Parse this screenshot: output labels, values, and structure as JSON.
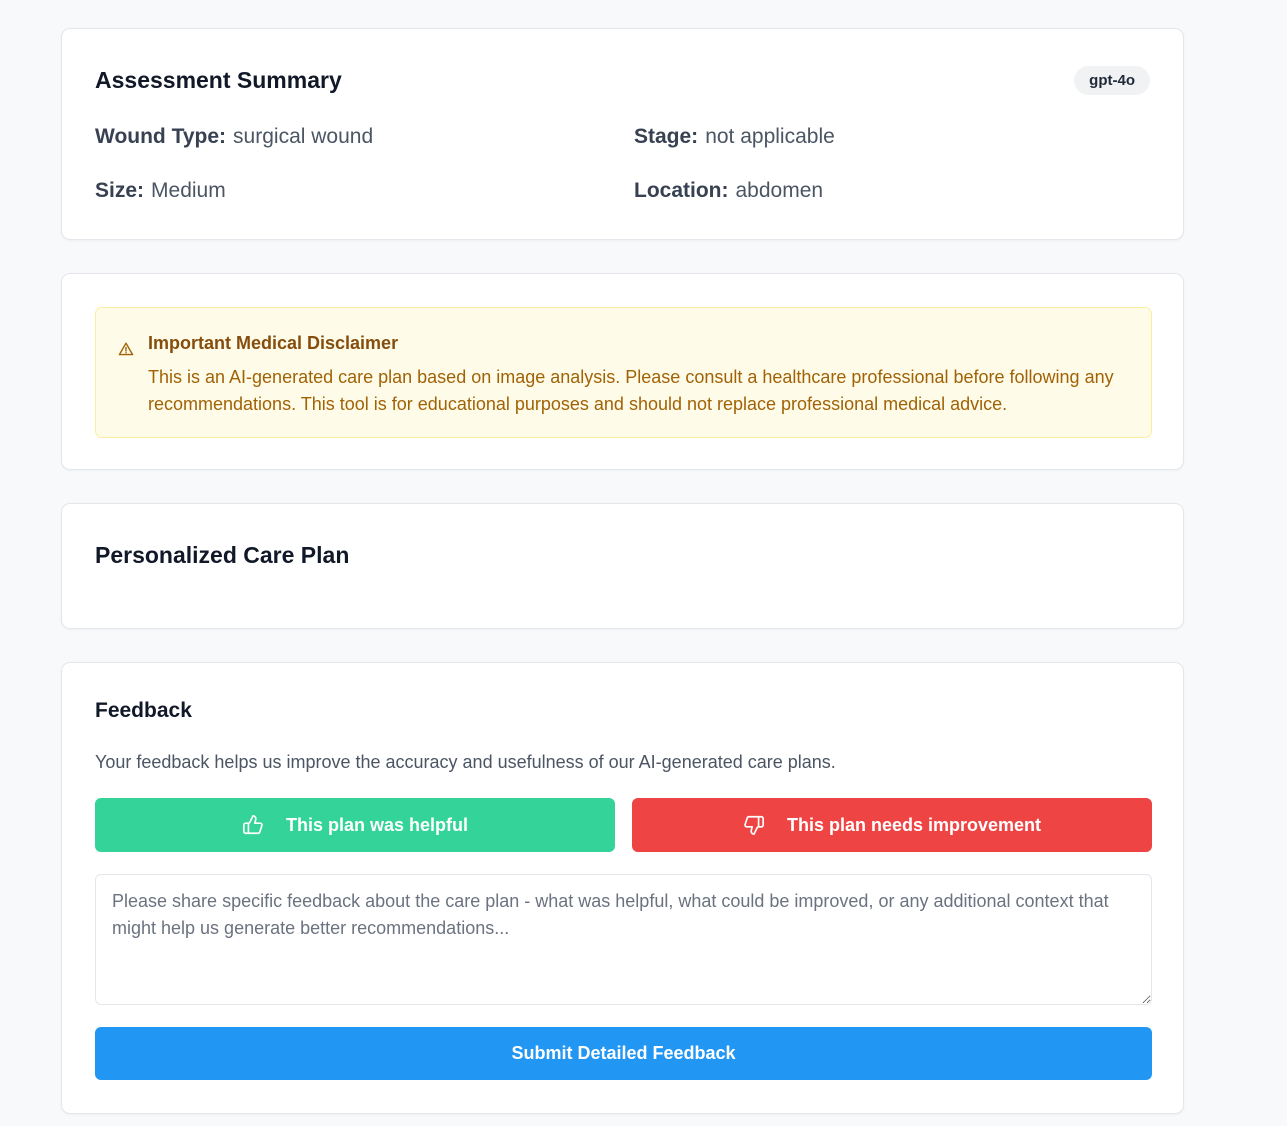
{
  "assessment": {
    "title": "Assessment Summary",
    "model_badge": "gpt-4o",
    "fields": {
      "wound_type": {
        "label": "Wound Type:",
        "value": "surgical wound"
      },
      "stage": {
        "label": "Stage:",
        "value": "not applicable"
      },
      "size": {
        "label": "Size:",
        "value": "Medium"
      },
      "location": {
        "label": "Location:",
        "value": "abdomen"
      }
    }
  },
  "disclaimer": {
    "icon": "warning-triangle-icon",
    "title": "Important Medical Disclaimer",
    "body": "This is an AI-generated care plan based on image analysis. Please consult a healthcare professional before following any recommendations. This tool is for educational purposes and should not replace professional medical advice."
  },
  "care_plan": {
    "title": "Personalized Care Plan"
  },
  "feedback": {
    "title": "Feedback",
    "description": "Your feedback helps us improve the accuracy and usefulness of our AI-generated care plans.",
    "helpful_label": "This plan was helpful",
    "helpful_icon": "thumbs-up-icon",
    "improve_label": "This plan needs improvement",
    "improve_icon": "thumbs-down-icon",
    "textarea_value": "",
    "textarea_placeholder": "Please share specific feedback about the care plan - what was helpful, what could be improved, or any additional context that might help us generate better recommendations...",
    "submit_label": "Submit Detailed Feedback"
  },
  "colors": {
    "page_background": "#f8f9fb",
    "helpful_button": "#34d399",
    "improve_button": "#ef4444",
    "submit_button": "#2196f3",
    "alert_background": "#fefce8",
    "alert_title": "#854d0e",
    "alert_text": "#a16207"
  }
}
